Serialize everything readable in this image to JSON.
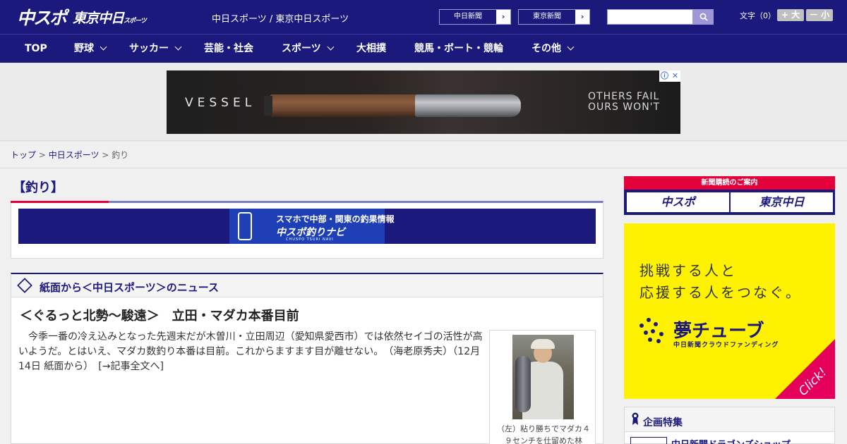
{
  "header": {
    "logo_main": "中スポ",
    "logo_sub": "東京中日",
    "logo_sub_small": "スポーツ",
    "site_name": "中日スポーツ / 東京中日スポーツ",
    "link_chunichi": "中日新聞",
    "link_tokyo": "東京新聞",
    "search_placeholder": "",
    "font_size_label": "文字（0）",
    "font_bigger": "+ 大",
    "font_smaller": "－ 小"
  },
  "nav": {
    "items": [
      {
        "label": "TOP",
        "has_menu": false
      },
      {
        "label": "野球",
        "has_menu": true
      },
      {
        "label": "サッカー",
        "has_menu": true
      },
      {
        "label": "芸能・社会",
        "has_menu": false
      },
      {
        "label": "スポーツ",
        "has_menu": true
      },
      {
        "label": "大相撲",
        "has_menu": false
      },
      {
        "label": "競馬・ボート・競輪",
        "has_menu": false
      },
      {
        "label": "その他",
        "has_menu": true
      }
    ]
  },
  "ad": {
    "brand": "VESSEL",
    "tagline_1": "OTHERS FAIL",
    "tagline_2": "OURS WON'T",
    "info_icon": "ⓘ",
    "close_icon": "✕"
  },
  "breadcrumb": {
    "items": [
      "トップ",
      "中日スポーツ",
      "釣り"
    ],
    "separator": " > "
  },
  "category": {
    "title": "【釣り】",
    "navi_banner_line1": "スマホで中部・関東の釣果情報",
    "navi_banner_line2": "中スポ釣りナビ",
    "navi_banner_line3": "CHUSPO TSURI NAVI"
  },
  "news": {
    "section_title": "紙面から＜中日スポーツ＞のニュース",
    "article_title": "＜ぐるっと北勢～駿遠＞　立田・マダカ本番目前",
    "article_body": "今季一番の冷え込みとなった先週末だが木曽川・立田周辺（愛知県愛西市）では依然セイゴの活性が高いようだ。とはいえ、マダカ数釣り本番は目前。これからますます目が離せない。　（海老原秀夫）（12月14日 紙面から）　[→記事全文へ]",
    "photo_caption": "（左）粘り勝ちでマダカ４９センチを仕留めた林"
  },
  "sidebar": {
    "subscribe_head": "新聞購読のご案内",
    "subscribe_btn_1": "中スポ",
    "subscribe_btn_2": "東京中日",
    "yume_line1": "挑戦する人と",
    "yume_line2": "応援する人をつなぐ。",
    "yume_logo": "夢チューブ",
    "yume_sub": "中日新聞クラウドファンディング",
    "yume_click": "Click!",
    "plan_title": "企画特集",
    "plan_item": "中日新聞ドラゴンズショップ"
  },
  "colors": {
    "navy": "#1b1a7c",
    "red": "#e4003a",
    "yellow": "#fff200"
  }
}
